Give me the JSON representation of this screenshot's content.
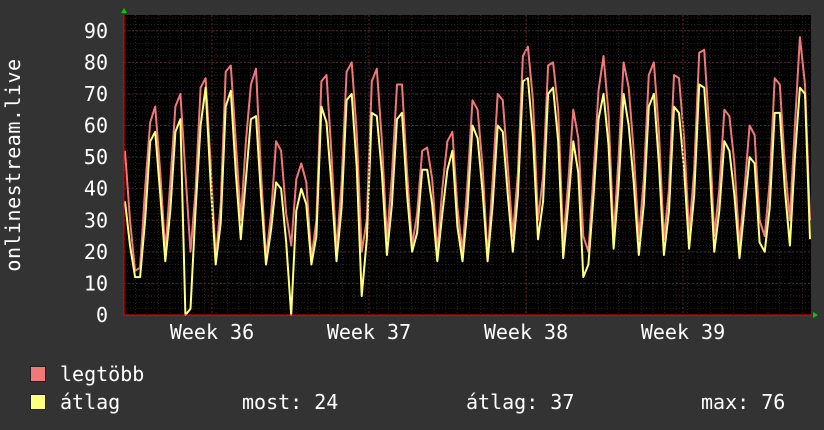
{
  "chart_data": {
    "type": "line",
    "ylabel": "onlinestream.live",
    "ylim": [
      0,
      95
    ],
    "yticks": [
      0,
      10,
      20,
      30,
      40,
      50,
      60,
      70,
      80,
      90
    ],
    "xtick_labels": [
      "Week 36",
      "Week 37",
      "Week 38",
      "Week 39"
    ],
    "grid": true,
    "series": [
      {
        "name": "legtöbb",
        "color": "#f07878",
        "values": [
          52,
          30,
          14,
          15,
          40,
          61,
          66,
          45,
          20,
          42,
          66,
          70,
          45,
          20,
          39,
          72,
          75,
          48,
          18,
          35,
          77,
          79,
          55,
          30,
          55,
          73,
          78,
          45,
          18,
          32,
          55,
          52,
          32,
          22,
          43,
          48,
          42,
          18,
          30,
          74,
          76,
          51,
          20,
          42,
          77,
          80,
          58,
          20,
          30,
          74,
          78,
          55,
          24,
          44,
          73,
          73,
          45,
          22,
          32,
          52,
          53,
          43,
          20,
          40,
          55,
          58,
          34,
          20,
          42,
          68,
          65,
          47,
          18,
          43,
          70,
          68,
          47,
          25,
          45,
          82,
          85,
          68,
          30,
          44,
          79,
          80,
          65,
          23,
          42,
          65,
          56,
          25,
          20,
          44,
          71,
          82,
          64,
          25,
          50,
          80,
          72,
          52,
          24,
          43,
          76,
          80,
          58,
          24,
          40,
          76,
          75,
          56,
          26,
          46,
          83,
          84,
          59,
          25,
          40,
          65,
          63,
          48,
          22,
          40,
          60,
          57,
          30,
          25,
          42,
          75,
          73,
          48,
          30,
          60,
          88,
          73,
          30
        ]
      },
      {
        "name": "átlag",
        "color": "#ffff80",
        "values": [
          36,
          22,
          12,
          12,
          30,
          55,
          58,
          38,
          17,
          33,
          58,
          62,
          0,
          2,
          33,
          60,
          72,
          42,
          16,
          29,
          66,
          71,
          45,
          24,
          43,
          62,
          63,
          38,
          16,
          27,
          42,
          40,
          23,
          0,
          33,
          40,
          35,
          16,
          25,
          66,
          61,
          41,
          17,
          34,
          68,
          70,
          47,
          6,
          24,
          64,
          63,
          45,
          19,
          35,
          62,
          64,
          38,
          20,
          26,
          46,
          46,
          35,
          17,
          32,
          46,
          52,
          28,
          17,
          34,
          60,
          56,
          39,
          17,
          35,
          60,
          58,
          38,
          20,
          38,
          74,
          75,
          56,
          24,
          36,
          70,
          72,
          55,
          18,
          35,
          55,
          45,
          12,
          16,
          37,
          62,
          70,
          54,
          21,
          41,
          70,
          60,
          42,
          19,
          35,
          66,
          70,
          48,
          19,
          33,
          66,
          64,
          46,
          21,
          38,
          73,
          72,
          49,
          20,
          33,
          55,
          52,
          38,
          18,
          34,
          50,
          48,
          23,
          20,
          34,
          64,
          64,
          40,
          22,
          50,
          72,
          70,
          24
        ]
      }
    ]
  },
  "legend": {
    "series1_label": "legtöbb",
    "series2_label": "átlag",
    "stat_now": "most: 24",
    "stat_avg": "átlag: 37",
    "stat_max": "max: 76"
  },
  "colors": {
    "background": "#333333",
    "plot_background": "#000000",
    "grid": "#4a2a2a",
    "axis": "#ff0000",
    "text": "#ffffff",
    "arrow": "#00cc00"
  }
}
